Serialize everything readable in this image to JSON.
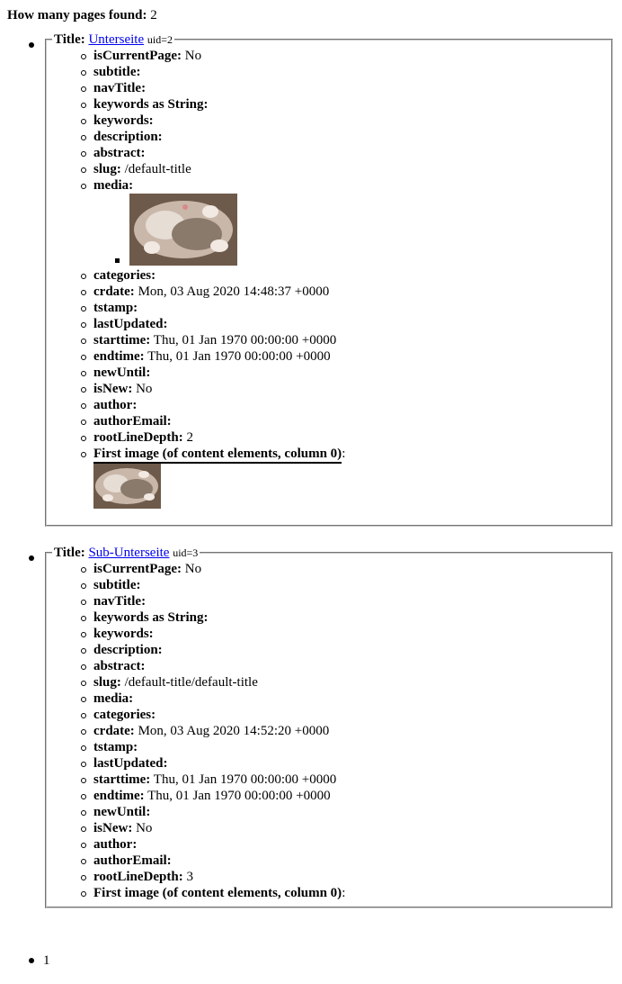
{
  "summary": {
    "label": "How many pages found:",
    "count": "2"
  },
  "pages": [
    {
      "title_label": "Title:",
      "title_link": "Unterseite",
      "uid": "uid=2",
      "props": {
        "isCurrentPage": "No",
        "subtitle": "",
        "navTitle": "",
        "keywordsString": "",
        "keywords": "",
        "description": "",
        "abstract": "",
        "slug": "/default-title",
        "media": "",
        "categories": "",
        "crdate": "Mon, 03 Aug 2020 14:48:37 +0000",
        "tstamp": "",
        "lastUpdated": "",
        "starttime": "Thu, 01 Jan 1970 00:00:00 +0000",
        "endtime": "Thu, 01 Jan 1970 00:00:00 +0000",
        "newUntil": "",
        "isNew": "No",
        "author": "",
        "authorEmail": "",
        "rootLineDepth": "2"
      }
    },
    {
      "title_label": "Title:",
      "title_link": "Sub-Unterseite",
      "uid": "uid=3",
      "props": {
        "isCurrentPage": "No",
        "subtitle": "",
        "navTitle": "",
        "keywordsString": "",
        "keywords": "",
        "description": "",
        "abstract": "",
        "slug": "/default-title/default-title",
        "media": "",
        "categories": "",
        "crdate": "Mon, 03 Aug 2020 14:52:20 +0000",
        "tstamp": "",
        "lastUpdated": "",
        "starttime": "Thu, 01 Jan 1970 00:00:00 +0000",
        "endtime": "Thu, 01 Jan 1970 00:00:00 +0000",
        "newUntil": "",
        "isNew": "No",
        "author": "",
        "authorEmail": "",
        "rootLineDepth": "3"
      }
    }
  ],
  "labels": {
    "isCurrentPage": "isCurrentPage:",
    "subtitle": "subtitle:",
    "navTitle": "navTitle:",
    "keywordsString": "keywords as String:",
    "keywords": "keywords:",
    "description": "description:",
    "abstract": "abstract:",
    "slug": "slug:",
    "media": "media:",
    "categories": "categories:",
    "crdate": "crdate:",
    "tstamp": "tstamp:",
    "lastUpdated": "lastUpdated:",
    "starttime": "starttime:",
    "endtime": "endtime:",
    "newUntil": "newUntil:",
    "isNew": "isNew:",
    "author": "author:",
    "authorEmail": "authorEmail:",
    "rootLineDepth": "rootLineDepth:",
    "firstImage": "First image (of content elements, column 0)",
    "firstImageColon": ":"
  },
  "pager": {
    "page": "1"
  },
  "images": {
    "kitten_icon": "kitten-photo"
  }
}
